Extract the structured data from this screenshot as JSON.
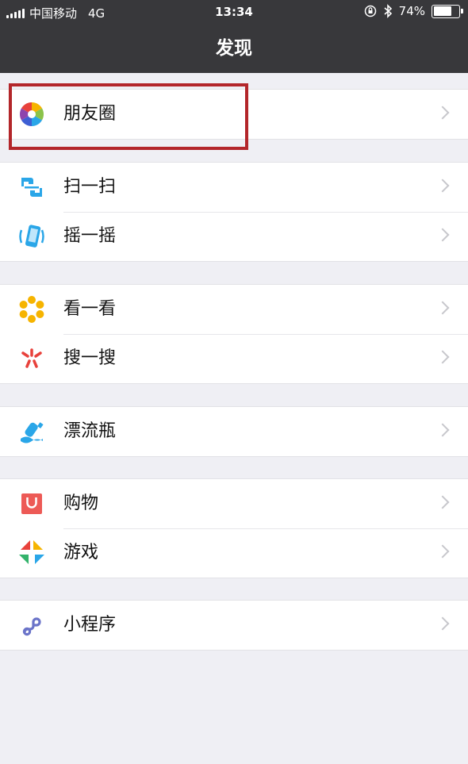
{
  "status_bar": {
    "carrier": "中国移动",
    "network": "4G",
    "time": "13:34",
    "battery_percent": "74%",
    "battery_level": 0.74
  },
  "nav": {
    "title": "发现"
  },
  "groups": [
    [
      {
        "label": "朋友圈",
        "icon": "moments-icon"
      }
    ],
    [
      {
        "label": "扫一扫",
        "icon": "scan-icon"
      },
      {
        "label": "摇一摇",
        "icon": "shake-icon"
      }
    ],
    [
      {
        "label": "看一看",
        "icon": "top-stories-icon"
      },
      {
        "label": "搜一搜",
        "icon": "search-icon"
      }
    ],
    [
      {
        "label": "漂流瓶",
        "icon": "drift-bottle-icon"
      }
    ],
    [
      {
        "label": "购物",
        "icon": "shopping-icon"
      },
      {
        "label": "游戏",
        "icon": "games-icon"
      }
    ],
    [
      {
        "label": "小程序",
        "icon": "mini-programs-icon"
      }
    ]
  ],
  "colors": {
    "navbar": "#38383b",
    "background": "#efeff4",
    "highlight": "#b3262a"
  }
}
